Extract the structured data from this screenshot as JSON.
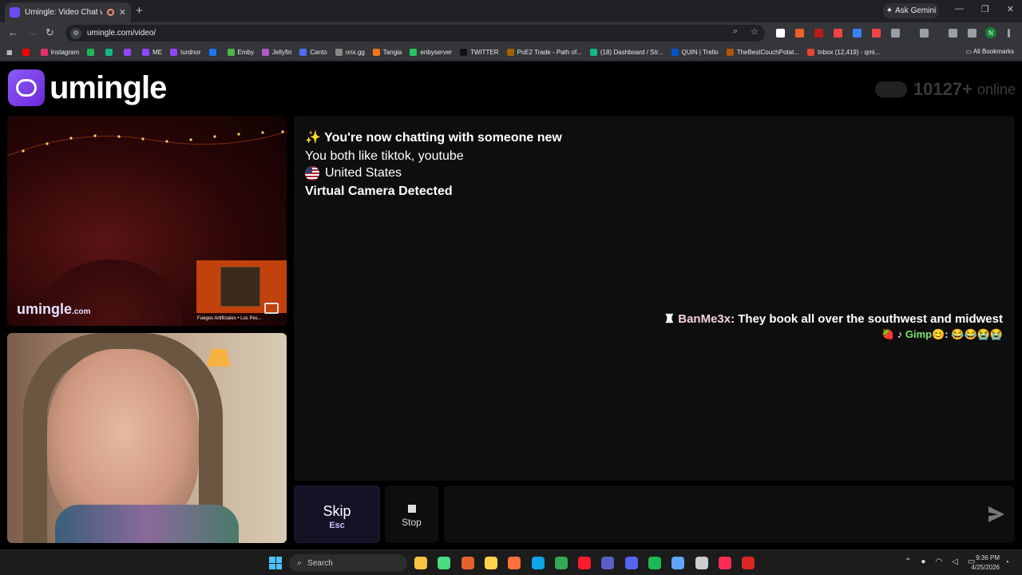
{
  "browser": {
    "tab_title": "Umingle: Video Chat with S",
    "tab_close": "✕",
    "new_tab": "+",
    "ask_gemini": "Ask Gemini",
    "url": "umingle.com/video/",
    "profile_initial": "N",
    "window_minimize": "—",
    "window_restore": "❐",
    "window_close": "✕"
  },
  "bookmarks": [
    {
      "label": "",
      "color": "#ff0000"
    },
    {
      "label": "Instagram",
      "color": "#e1306c"
    },
    {
      "label": "",
      "color": "#1db954"
    },
    {
      "label": "",
      "color": "#10b981"
    },
    {
      "label": "",
      "color": "#9146ff"
    },
    {
      "label": "ME",
      "color": "#9146ff"
    },
    {
      "label": "turdnor",
      "color": "#9146ff"
    },
    {
      "label": "",
      "color": "#1877f2"
    },
    {
      "label": "Emby",
      "color": "#52b54b"
    },
    {
      "label": "Jellyfin",
      "color": "#aa5cc3"
    },
    {
      "label": "Canto",
      "color": "#4a6cf7"
    },
    {
      "label": "onx.gg",
      "color": "#888888"
    },
    {
      "label": "Tangia",
      "color": "#f97316"
    },
    {
      "label": "enbyserver",
      "color": "#22c55e"
    },
    {
      "label": "TWITTER",
      "color": "#111111"
    },
    {
      "label": "PoE2 Trade - Path of...",
      "color": "#a16207"
    },
    {
      "label": "(18) Dashboard / Str...",
      "color": "#10b981"
    },
    {
      "label": "QUIN | Trello",
      "color": "#0052cc"
    },
    {
      "label": "TheBestCouchPotat...",
      "color": "#b45309"
    },
    {
      "label": "Inbox (12,419) - qmi...",
      "color": "#ea4335"
    }
  ],
  "all_bookmarks": "All Bookmarks",
  "site": {
    "logo_text": "umingle",
    "online_count": "10127+",
    "online_label": "online"
  },
  "stranger_video": {
    "brand": "umingle",
    "brand_suffix": ".com",
    "overlay_caption": "Fuegos Artificiales • Los Pes..."
  },
  "chat": {
    "new_chat": "✨ You're now chatting with someone new",
    "shared_interests": "You both like tiktok, youtube",
    "country": "United States",
    "camera_notice": "Virtual Camera Detected",
    "incoming": {
      "prefix_icon": "♜",
      "name": "BanMe3x",
      "text": ": They book all over the southwest and midwest",
      "line2_prefix": "🍓 ♪ ",
      "line2_name": "Gimp",
      "line2_suffix": "😊: 😂😂😭😭"
    }
  },
  "controls": {
    "skip_label": "Skip",
    "skip_key": "Esc",
    "stop_label": "Stop",
    "message_placeholder": ""
  },
  "taskbar": {
    "search_label": "Search",
    "time": "9:36 PM",
    "date": "4/25/2026",
    "apps": [
      {
        "name": "windows-explorer-icon",
        "color": "#f6c343"
      },
      {
        "name": "media-player-icon",
        "color": "#4ade80"
      },
      {
        "name": "app-orange-icon",
        "color": "#e8612c"
      },
      {
        "name": "sticky-notes-icon",
        "color": "#fcd34d"
      },
      {
        "name": "firefox-icon",
        "color": "#ff7139"
      },
      {
        "name": "edge-icon",
        "color": "#0ea5e9"
      },
      {
        "name": "chrome-icon",
        "color": "#34a853"
      },
      {
        "name": "opera-icon",
        "color": "#ff1b2d"
      },
      {
        "name": "teams-icon",
        "color": "#5b5fc7"
      },
      {
        "name": "discord-icon",
        "color": "#5865f2"
      },
      {
        "name": "spotify-icon",
        "color": "#1db954"
      },
      {
        "name": "notepad-icon",
        "color": "#60a5fa"
      },
      {
        "name": "obs-icon",
        "color": "#cccccc"
      },
      {
        "name": "tiktok-icon",
        "color": "#fe2c55"
      },
      {
        "name": "app-red-icon",
        "color": "#dc2626"
      }
    ]
  }
}
